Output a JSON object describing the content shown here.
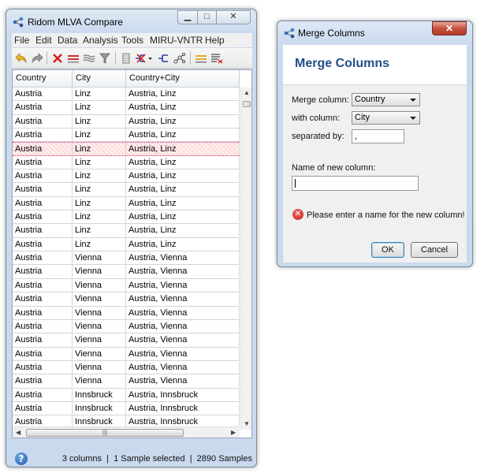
{
  "main_window": {
    "title": "Ridom MLVA Compare",
    "menu": [
      "File",
      "Edit",
      "Data",
      "Analysis",
      "Tools",
      "MIRU-VNTR",
      "Help"
    ],
    "table": {
      "columns": [
        "Country",
        "City",
        "Country+City"
      ],
      "rows": [
        [
          "Austria",
          "Linz",
          "Austria, Linz"
        ],
        [
          "Austria",
          "Linz",
          "Austria, Linz"
        ],
        [
          "Austria",
          "Linz",
          "Austria, Linz"
        ],
        [
          "Austria",
          "Linz",
          "Austria, Linz"
        ],
        [
          "Austria",
          "Linz",
          "Austria, Linz"
        ],
        [
          "Austria",
          "Linz",
          "Austria, Linz"
        ],
        [
          "Austria",
          "Linz",
          "Austria, Linz"
        ],
        [
          "Austria",
          "Linz",
          "Austria, Linz"
        ],
        [
          "Austria",
          "Linz",
          "Austria, Linz"
        ],
        [
          "Austria",
          "Linz",
          "Austria, Linz"
        ],
        [
          "Austria",
          "Linz",
          "Austria, Linz"
        ],
        [
          "Austria",
          "Linz",
          "Austria, Linz"
        ],
        [
          "Austria",
          "Vienna",
          "Austria, Vienna"
        ],
        [
          "Austria",
          "Vienna",
          "Austria, Vienna"
        ],
        [
          "Austria",
          "Vienna",
          "Austria, Vienna"
        ],
        [
          "Austria",
          "Vienna",
          "Austria, Vienna"
        ],
        [
          "Austria",
          "Vienna",
          "Austria, Vienna"
        ],
        [
          "Austria",
          "Vienna",
          "Austria, Vienna"
        ],
        [
          "Austria",
          "Vienna",
          "Austria, Vienna"
        ],
        [
          "Austria",
          "Vienna",
          "Austria, Vienna"
        ],
        [
          "Austria",
          "Vienna",
          "Austria, Vienna"
        ],
        [
          "Austria",
          "Vienna",
          "Austria, Vienna"
        ],
        [
          "Austria",
          "Innsbruck",
          "Austria, Innsbruck"
        ],
        [
          "Austria",
          "Innsbruck",
          "Austria, Innsbruck"
        ],
        [
          "Austria",
          "Innsbruck",
          "Austria, Innsbruck"
        ]
      ],
      "selected_row": 4
    },
    "status": "3 columns  |  1 Sample selected  |  2890 Samples"
  },
  "dialog": {
    "title": "Merge Columns",
    "heading": "Merge Columns",
    "merge_column_label": "Merge column:",
    "merge_column_value": "Country",
    "with_column_label": "with column:",
    "with_column_value": "City",
    "separated_by_label": "separated by:",
    "separator_value": ",",
    "new_column_label": "Name of new column:",
    "new_column_value": "",
    "error_message": "Please enter a name for the new column!",
    "ok_label": "OK",
    "cancel_label": "Cancel"
  },
  "colors": {
    "heading_blue": "#234f86",
    "error_red": "#c31d1d",
    "selection_pink": "#ffd9d9"
  }
}
